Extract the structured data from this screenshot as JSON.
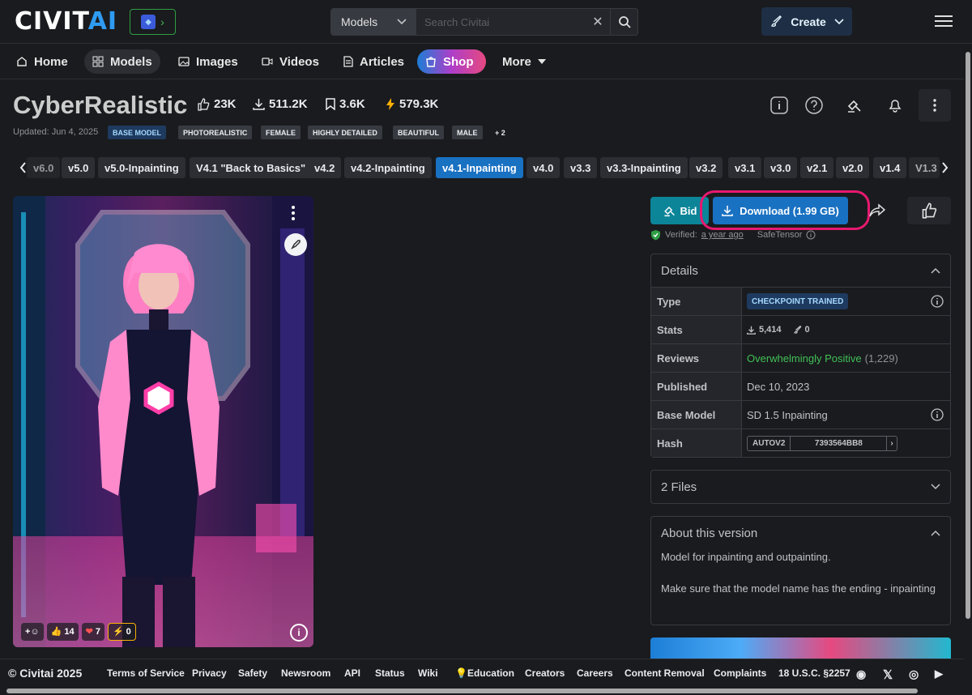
{
  "header": {
    "logo_main": "CIVIT",
    "logo_ai": "AI",
    "search_scope": "Models",
    "search_placeholder": "Search Civitai",
    "create_label": "Create"
  },
  "nav": {
    "home": "Home",
    "models": "Models",
    "images": "Images",
    "videos": "Videos",
    "articles": "Articles",
    "shop": "Shop",
    "more": "More"
  },
  "model": {
    "title": "CyberRealistic",
    "likes": "23K",
    "downloads": "511.2K",
    "bookmarks": "3.6K",
    "buzz": "579.3K",
    "updated": "Updated: Jun 4, 2025",
    "tags": [
      "BASE MODEL",
      "PHOTOREALISTIC",
      "FEMALE",
      "HIGHLY DETAILED",
      "BEAUTIFUL",
      "MALE",
      "+ 2"
    ]
  },
  "versions": [
    "v6.0",
    "v5.0",
    "v5.0-Inpainting",
    "V4.1 \"Back to Basics\"",
    "v4.2",
    "v4.2-Inpainting",
    "v4.1-Inpainting",
    "v4.0",
    "v3.3",
    "v3.3-Inpainting",
    "v3.2",
    "v3.1",
    "v3.0",
    "v2.1",
    "v2.0",
    "v1.4",
    "V1.3"
  ],
  "image": {
    "reactions": {
      "thumbs": "14",
      "heart": "7",
      "buzz": "0"
    }
  },
  "actions": {
    "bid": "Bid",
    "download": "Download (1.99 GB)",
    "verified_prefix": "Verified:",
    "verified_when": "a year ago",
    "format": "SafeTensor"
  },
  "details": {
    "title": "Details",
    "rows": {
      "type_k": "Type",
      "type_v": "CHECKPOINT TRAINED",
      "stats_k": "Stats",
      "stats_dl": "5,414",
      "stats_gen": "0",
      "reviews_k": "Reviews",
      "reviews_v": "Overwhelmingly Positive",
      "reviews_count": "(1,229)",
      "published_k": "Published",
      "published_v": "Dec 10, 2023",
      "base_k": "Base Model",
      "base_v": "SD 1.5 Inpainting",
      "hash_k": "Hash",
      "hash_type": "AUTOV2",
      "hash_v": "7393564BB8"
    }
  },
  "files": {
    "title": "2 Files"
  },
  "about": {
    "title": "About this version",
    "p1": "Model for inpainting and outpainting.",
    "p2": "Make sure that the model name has the ending - inpainting"
  },
  "footer": {
    "copyright": "© Civitai 2025",
    "links": [
      "Terms of Service",
      "Privacy",
      "Safety",
      "Newsroom",
      "API",
      "Status",
      "Wiki",
      "Education",
      "Creators",
      "Careers",
      "Content Removal",
      "Complaints",
      "18 U.S.C. §2257"
    ]
  },
  "colors": {
    "accent": "#1971c2",
    "bid": "#0c8599",
    "highlight": "#e6196f",
    "positive": "#40c057"
  }
}
